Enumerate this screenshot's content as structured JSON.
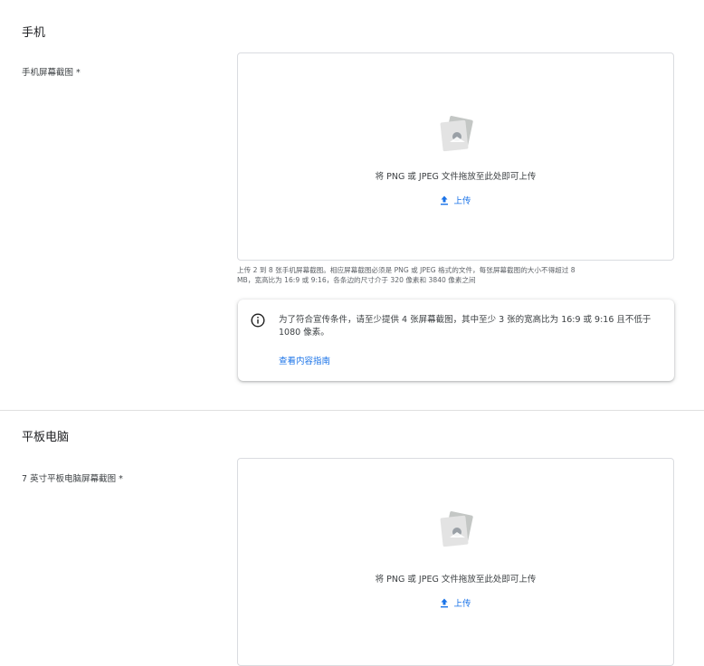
{
  "phone": {
    "section_title": "手机",
    "screenshot_label": "手机屏幕截图 *",
    "dropzone_text": "将 PNG 或 JPEG 文件拖放至此处即可上传",
    "upload_label": "上传",
    "helper_line1": "上传 2 到 8 张手机屏幕截图。相应屏幕截图必须是 PNG 或 JPEG 格式的文件，每张屏幕截图的大小不得超过 8",
    "helper_line2": "MB，宽高比为 16:9 或 9:16，各条边的尺寸介于 320 像素和 3840 像素之间",
    "info_text": "为了符合宣传条件，请至少提供 4 张屏幕截图，其中至少 3 张的宽高比为 16:9 或 9:16 且不低于 1080 像素。",
    "info_link": "查看内容指南"
  },
  "tablet": {
    "section_title": "平板电脑",
    "screenshot_label": "7 英寸平板电脑屏幕截图 *",
    "dropzone_text": "将 PNG 或 JPEG 文件拖放至此处即可上传",
    "upload_label": "上传"
  },
  "colors": {
    "link_blue": "#1a73e8",
    "border": "#dadce0",
    "text_secondary": "#5f6368"
  },
  "icons": {
    "dropzone": "image-placeholder-icon",
    "upload": "upload-icon",
    "info": "info-icon"
  }
}
